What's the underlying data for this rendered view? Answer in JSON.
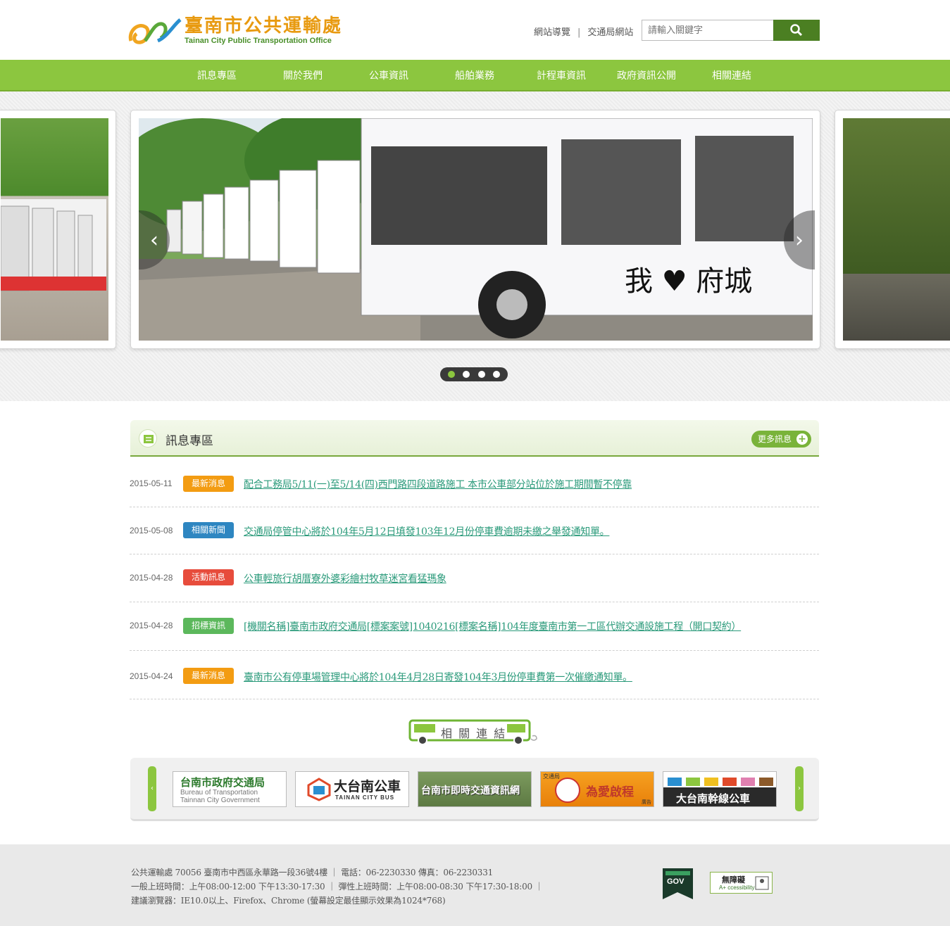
{
  "header": {
    "logo_zh": "臺南市公共運輸處",
    "logo_en": "Tainan City Public Transportation Office",
    "links": [
      "網站導覽",
      "交通局網站"
    ],
    "search_placeholder": "請輸入關鍵字"
  },
  "nav": {
    "items": [
      "訊息專區",
      "關於我們",
      "公車資訊",
      "船舶業務",
      "計程車資訊",
      "政府資訊公開",
      "相關連結"
    ]
  },
  "banner": {
    "caption": "我♥府城",
    "slide_count": 4,
    "active_slide": 1
  },
  "news": {
    "title": "訊息專區",
    "more_label": "更多訊息",
    "items": [
      {
        "date": "2015-05-11",
        "tag": "最新消息",
        "tag_color": "#f39c12",
        "text": "配合工務局5/11(一)至5/14(四)西門路四段道路施工 本市公車部分站位於施工期間暫不停靠"
      },
      {
        "date": "2015-05-08",
        "tag": "相關新聞",
        "tag_color": "#2e86c1",
        "text": "交通局停管中心將於104年5月12日填發103年12月份停車費逾期未繳之舉發通知單。"
      },
      {
        "date": "2015-04-28",
        "tag": "活動訊息",
        "tag_color": "#e74c3c",
        "text": "公車輕旅行胡厝寮外婆彩繪村牧草迷宮看猛瑪象"
      },
      {
        "date": "2015-04-28",
        "tag": "招標資訊",
        "tag_color": "#5cb85c",
        "text": "[機關名稱]臺南市政府交通局[標案案號]1040216[標案名稱]104年度臺南市第一工區代辦交通設施工程（開口契約）"
      },
      {
        "date": "2015-04-24",
        "tag": "最新消息",
        "tag_color": "#f39c12",
        "text": "臺南市公有停車場管理中心將於104年4月28日寄發104年3月份停車費第一次催繳通知單。"
      }
    ]
  },
  "related": {
    "title": "相 關 連 結",
    "links": [
      {
        "line1": "台南市政府交通局",
        "line2": "Bureau of Transportation",
        "line3": "Tainnan City Government"
      },
      {
        "line1": "大台南公車",
        "line2": "TAINAN CITY BUS"
      },
      {
        "line1": "台南市即時交通資訊網"
      },
      {
        "line1": "為愛啟程",
        "line2": "交通局",
        "line3": "廣告"
      },
      {
        "line1": "大台南幹線公車"
      }
    ]
  },
  "footer": {
    "line1": "公共運輸處 70056 臺南市中西區永華路一段36號4樓 ｜ 電話：06-2230330 傳真：06-2230331",
    "line2": "一般上班時間：上午08:00-12:00  下午13:30-17:30 ｜ 彈性上班時間：上午08:00-08:30  下午17:30-18:00 ｜",
    "line3": "建議瀏覽器：IE10.0以上、Firefox、Chrome (螢幕設定最佳顯示效果為1024*768)",
    "gov_label": "GOV",
    "acc_label_1": "無障礙",
    "acc_label_2": "A+ ccessibility"
  },
  "colors": {
    "nav_green": "#8cc63f",
    "dark_green": "#4b7f22",
    "link_teal": "#2a9a7a",
    "logo_orange": "#e89a10"
  }
}
